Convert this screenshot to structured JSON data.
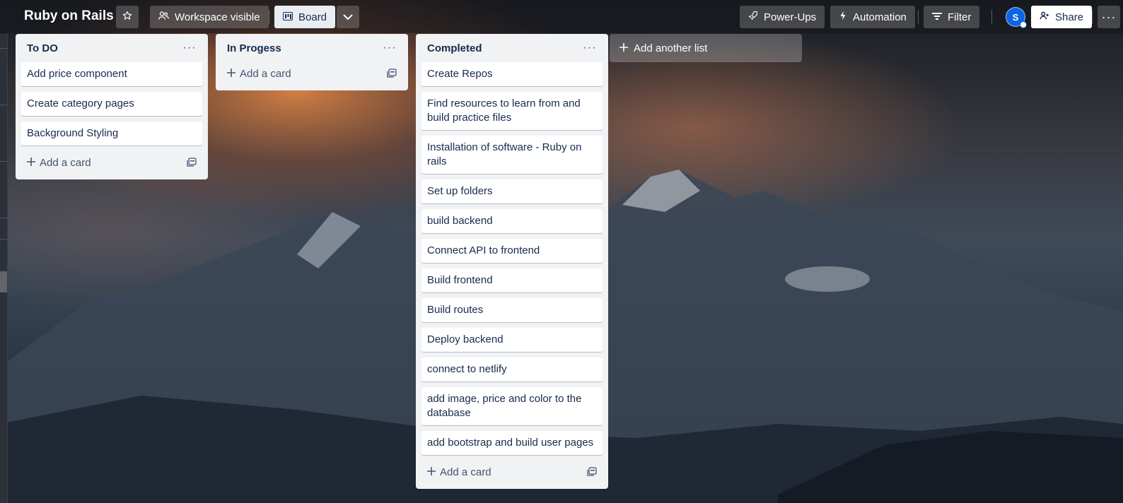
{
  "header": {
    "board_title": "Ruby on Rails",
    "star_icon": "star-icon",
    "visibility_label": "Workspace visible",
    "view_label": "Board",
    "powerups_label": "Power-Ups",
    "automation_label": "Automation",
    "filter_label": "Filter",
    "avatar_initial": "S",
    "share_label": "Share"
  },
  "lists": [
    {
      "title": "To DO",
      "cards": [
        "Add price component",
        "Create category pages",
        "Background Styling"
      ],
      "add_card_label": "Add a card"
    },
    {
      "title": "In Progess",
      "cards": [],
      "add_card_label": "Add a card"
    },
    {
      "title": "Completed",
      "cards": [
        "Create Repos",
        "Find resources to learn from and build practice files",
        "Installation of software - Ruby on rails",
        "Set up folders",
        "build backend",
        "Connect API to frontend",
        "Build frontend",
        "Build routes",
        "Deploy backend",
        "connect to netlify",
        "add image, price and color to the database",
        "add bootstrap and build user pages"
      ],
      "add_card_label": "Add a card"
    }
  ],
  "add_list_label": "Add another list",
  "colors": {
    "list_bg": "#f1f2f4",
    "card_text": "#172b4d",
    "accent": "#0c66e4"
  }
}
